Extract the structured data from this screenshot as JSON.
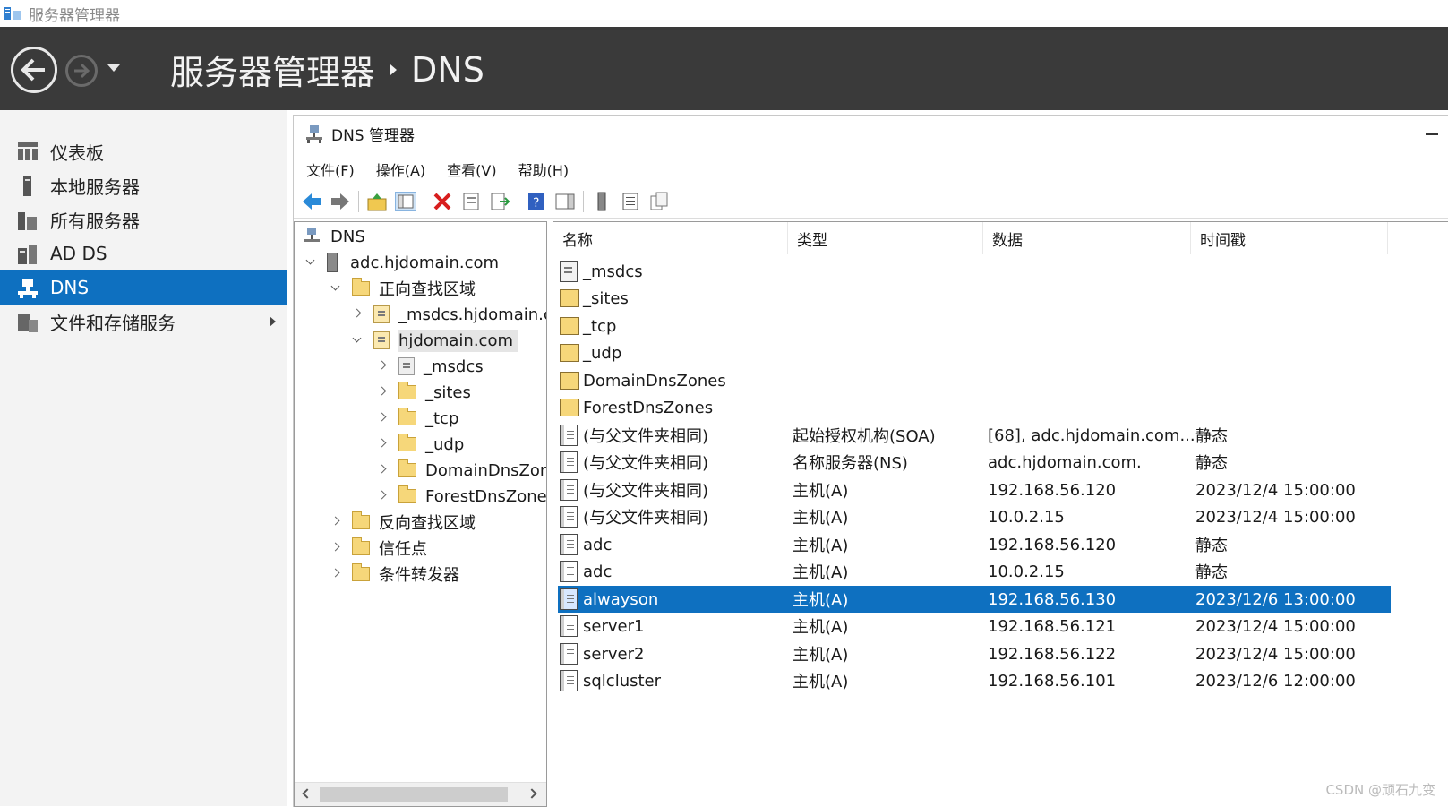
{
  "titlebar": {
    "title": "服务器管理器"
  },
  "header": {
    "crumb_root": "服务器管理器",
    "crumb_current": "DNS"
  },
  "leftnav": {
    "items": [
      {
        "label": "仪表板"
      },
      {
        "label": "本地服务器"
      },
      {
        "label": "所有服务器"
      },
      {
        "label": "AD DS"
      },
      {
        "label": "DNS"
      },
      {
        "label": "文件和存储服务"
      }
    ],
    "active_color": "#0e70c0"
  },
  "mmc": {
    "title": "DNS 管理器",
    "menu": [
      "文件(F)",
      "操作(A)",
      "查看(V)",
      "帮助(H)"
    ]
  },
  "tree": {
    "nodes": [
      "DNS",
      "adc.hjdomain.com",
      "正向查找区域",
      "_msdcs.hjdomain.com",
      "hjdomain.com",
      "_msdcs",
      "_sites",
      "_tcp",
      "_udp",
      "DomainDnsZones",
      "ForestDnsZones",
      "反向查找区域",
      "信任点",
      "条件转发器"
    ]
  },
  "list": {
    "headers": [
      "名称",
      "类型",
      "数据",
      "时间戳"
    ],
    "rows": [
      {
        "name": "_msdcs",
        "type": "",
        "data": "",
        "ts": ""
      },
      {
        "name": "_sites",
        "type": "",
        "data": "",
        "ts": ""
      },
      {
        "name": "_tcp",
        "type": "",
        "data": "",
        "ts": ""
      },
      {
        "name": "_udp",
        "type": "",
        "data": "",
        "ts": ""
      },
      {
        "name": "DomainDnsZones",
        "type": "",
        "data": "",
        "ts": ""
      },
      {
        "name": "ForestDnsZones",
        "type": "",
        "data": "",
        "ts": ""
      },
      {
        "name": "(与父文件夹相同)",
        "type": "起始授权机构(SOA)",
        "data": "[68], adc.hjdomain.com....",
        "ts": "静态"
      },
      {
        "name": "(与父文件夹相同)",
        "type": "名称服务器(NS)",
        "data": "adc.hjdomain.com.",
        "ts": "静态"
      },
      {
        "name": "(与父文件夹相同)",
        "type": "主机(A)",
        "data": "192.168.56.120",
        "ts": "2023/12/4 15:00:00"
      },
      {
        "name": "(与父文件夹相同)",
        "type": "主机(A)",
        "data": "10.0.2.15",
        "ts": "2023/12/4 15:00:00"
      },
      {
        "name": "adc",
        "type": "主机(A)",
        "data": "192.168.56.120",
        "ts": "静态"
      },
      {
        "name": "adc",
        "type": "主机(A)",
        "data": "10.0.2.15",
        "ts": "静态"
      },
      {
        "name": "alwayson",
        "type": "主机(A)",
        "data": "192.168.56.130",
        "ts": "2023/12/6 13:00:00"
      },
      {
        "name": "server1",
        "type": "主机(A)",
        "data": "192.168.56.121",
        "ts": "2023/12/4 15:00:00"
      },
      {
        "name": "server2",
        "type": "主机(A)",
        "data": "192.168.56.122",
        "ts": "2023/12/4 15:00:00"
      },
      {
        "name": "sqlcluster",
        "type": "主机(A)",
        "data": "192.168.56.101",
        "ts": "2023/12/6 12:00:00"
      }
    ]
  },
  "watermark": "CSDN @顽石九变"
}
